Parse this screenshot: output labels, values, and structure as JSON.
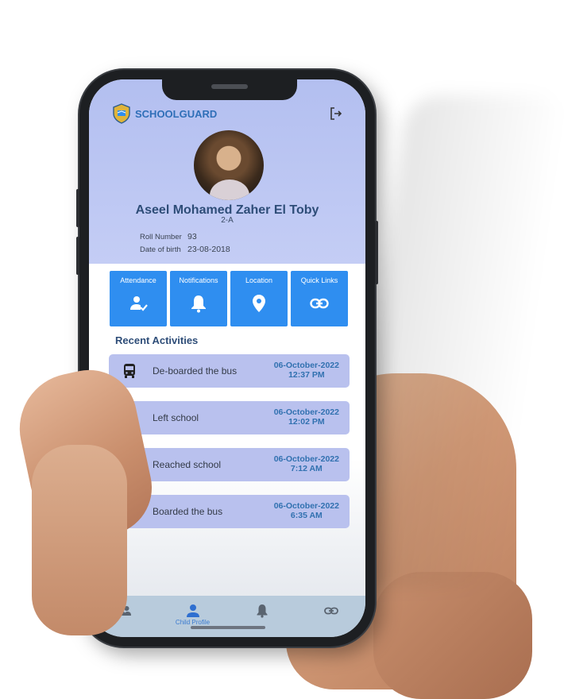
{
  "app": {
    "brand": "SCHOOLGUARD"
  },
  "profile": {
    "name": "Aseel Mohamed Zaher El Toby",
    "class": "2-A",
    "roll_label": "Roll Number",
    "roll_value": "93",
    "dob_label": "Date of birth",
    "dob_value": "23-08-2018"
  },
  "tiles": [
    {
      "label": "Attendance",
      "icon": "user-check-icon"
    },
    {
      "label": "Notifications",
      "icon": "bell-icon"
    },
    {
      "label": "Location",
      "icon": "location-pin-icon"
    },
    {
      "label": "Quick Links",
      "icon": "link-icon"
    }
  ],
  "recent": {
    "title": "Recent Activities",
    "items": [
      {
        "label": "De-boarded the bus",
        "date": "06-October-2022",
        "time": "12:37 PM",
        "icon": "bus-icon"
      },
      {
        "label": "Left school",
        "date": "06-October-2022",
        "time": "12:02 PM",
        "icon": "bus-icon"
      },
      {
        "label": "Reached school",
        "date": "06-October-2022",
        "time": "7:12 AM",
        "icon": "bus-icon"
      },
      {
        "label": "Boarded the bus",
        "date": "06-October-2022",
        "time": "6:35 AM",
        "icon": "bus-icon"
      }
    ]
  },
  "nav": {
    "items": [
      {
        "label": "",
        "icon": "group-icon"
      },
      {
        "label": "Child Profile",
        "icon": "person-icon"
      },
      {
        "label": "",
        "icon": "bell-icon"
      },
      {
        "label": "",
        "icon": "link-icon"
      }
    ]
  },
  "colors": {
    "header_bg": "#b9c4f2",
    "tile_bg": "#2f8ef0",
    "activity_bg": "#b9c1ee",
    "accent": "#3171b0",
    "nav_bg": "#b8cbdc"
  }
}
